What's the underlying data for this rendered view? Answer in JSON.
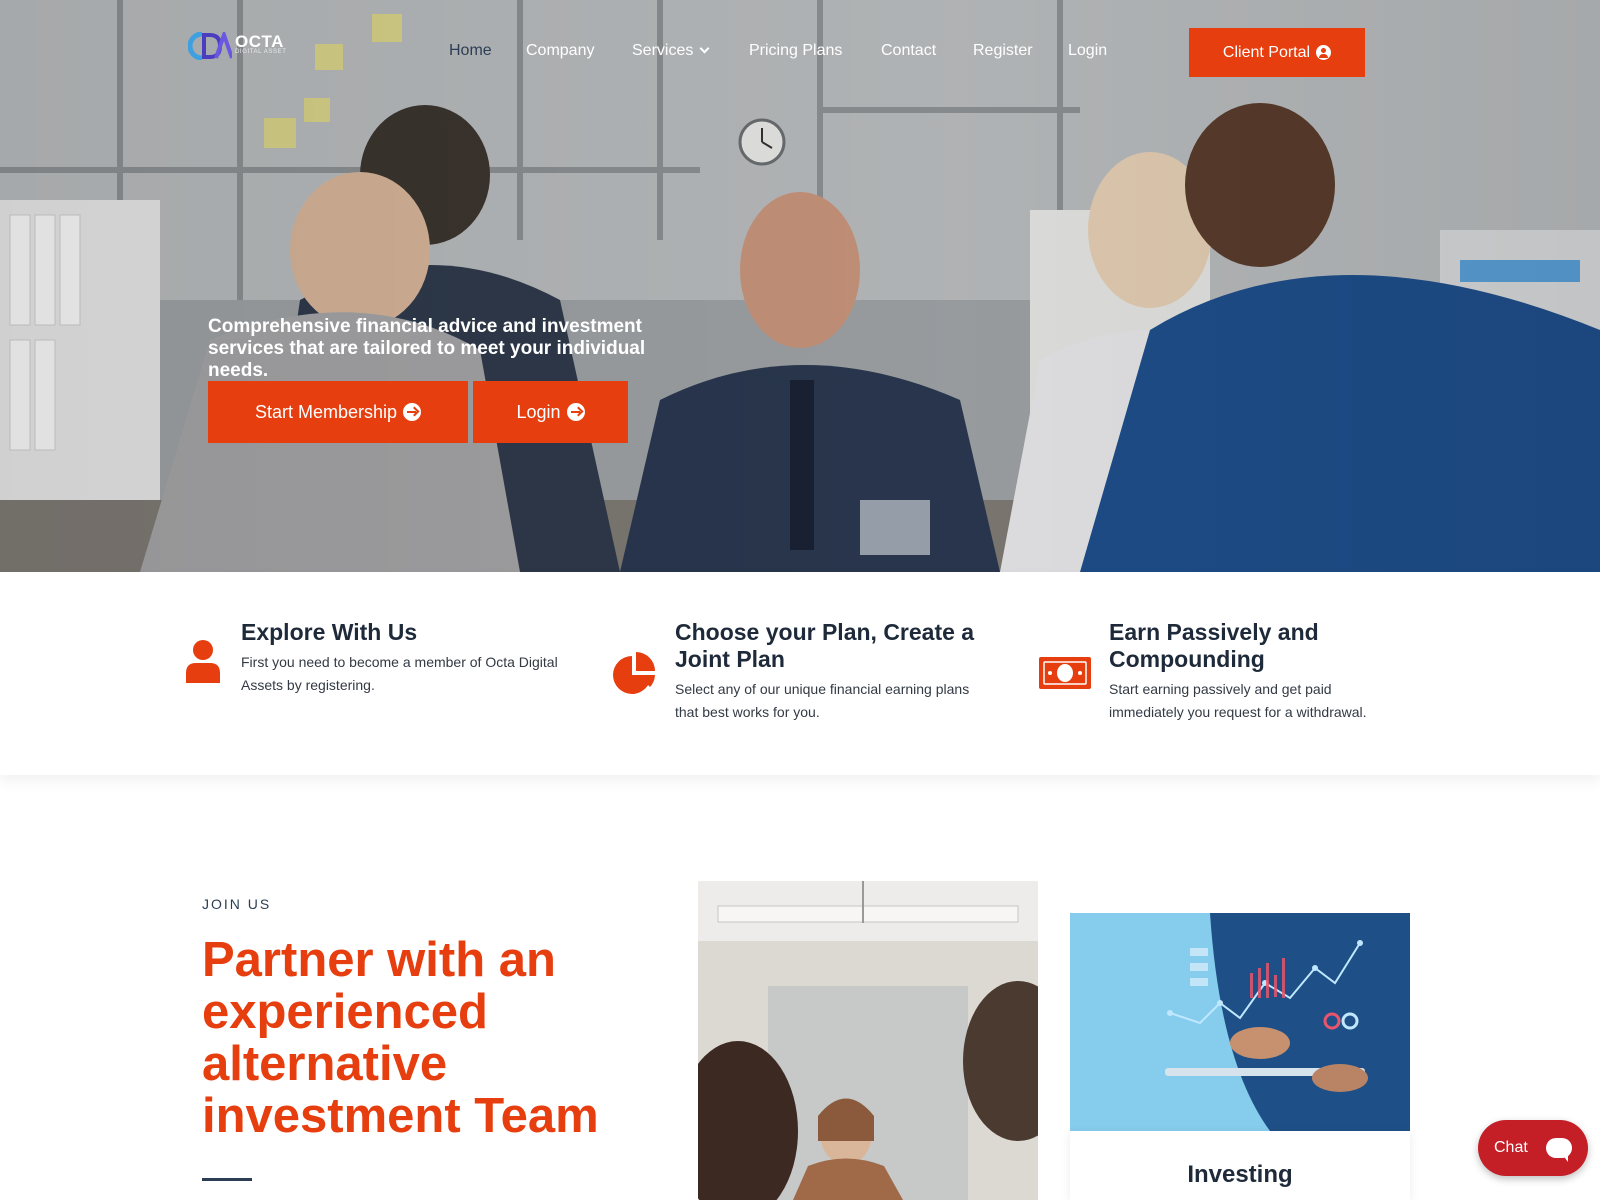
{
  "brand": {
    "name": "OCTA",
    "tagline": "DIGITAL ASSET",
    "accent_color": "#e63e0e",
    "navy_color": "#2c3e55"
  },
  "nav": {
    "items": [
      {
        "label": "Home",
        "active": true
      },
      {
        "label": "Company",
        "active": false
      },
      {
        "label": "Services",
        "active": false
      },
      {
        "label": "Pricing Plans",
        "active": false
      },
      {
        "label": "Contact",
        "active": false
      },
      {
        "label": "Register",
        "active": false
      },
      {
        "label": "Login",
        "active": false
      }
    ],
    "portal_label": "Client Portal"
  },
  "hero": {
    "text": "Comprehensive financial advice and investment services that are tailored to meet your individual needs.",
    "start_label": "Start Membership",
    "login_label": "Login"
  },
  "features": [
    {
      "icon": "user-icon",
      "title": "Explore With Us",
      "text": "First you need to become a member of Octa Digital Assets by registering."
    },
    {
      "icon": "pie-chart-icon",
      "title": "Choose your Plan, Create a Joint Plan",
      "text": "Select any of our unique financial earning plans that best works for you."
    },
    {
      "icon": "money-bill-icon",
      "title": "Earn Passively and Compounding",
      "text": "Start earning passively and get paid immediately you request for a withdrawal."
    }
  ],
  "join": {
    "eyebrow": "JOIN US",
    "title": "Partner with an experienced alternative investment Team"
  },
  "cards": {
    "investing_title": "Investing"
  },
  "chat": {
    "label": "Chat"
  }
}
